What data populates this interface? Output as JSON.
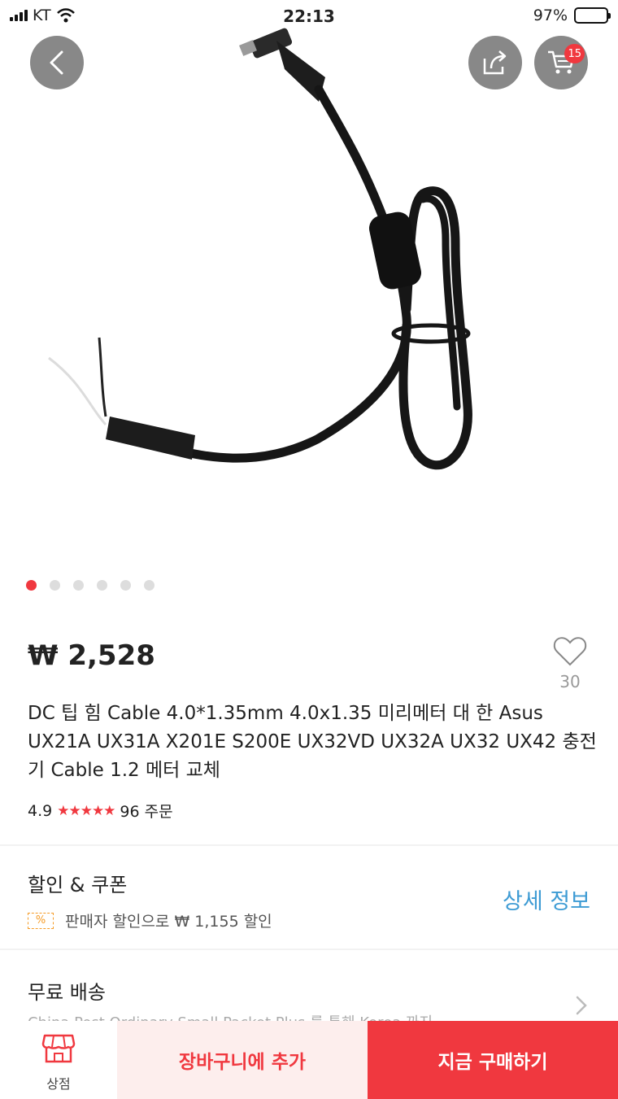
{
  "status_bar": {
    "carrier": "KT",
    "time": "22:13",
    "battery": "97%"
  },
  "header": {
    "cart_count": "15"
  },
  "gallery": {
    "dots": [
      true,
      false,
      false,
      false,
      false,
      false
    ]
  },
  "product": {
    "price": "₩ 2,528",
    "wishlist_count": "30",
    "title": "DC 팁 힘 Cable 4.0*1.35mm 4.0x1.35 미리메터 대 한 Asus UX21A UX31A X201E S200E UX32VD UX32A UX32 UX42 충전기 Cable 1.2 메터 교체",
    "rating": "4.9",
    "stars": "★★★★★",
    "orders": "96 주문"
  },
  "discount": {
    "title": "할인 & 쿠폰",
    "badge": "%",
    "text": "판매자 할인으로 ₩ 1,155 할인",
    "detail_link": "상세 정보"
  },
  "shipping": {
    "title": "무료 배송",
    "subtitle": "China Post Ordinary Small Packet Plus 를 통해 Korea 까지"
  },
  "bottom_bar": {
    "store_label": "상점",
    "add_to_cart": "장바구니에 추가",
    "buy_now": "지금 구매하기"
  },
  "colors": {
    "accent": "#f0383f",
    "link": "#3d9bd4",
    "coupon": "#f59c28"
  }
}
